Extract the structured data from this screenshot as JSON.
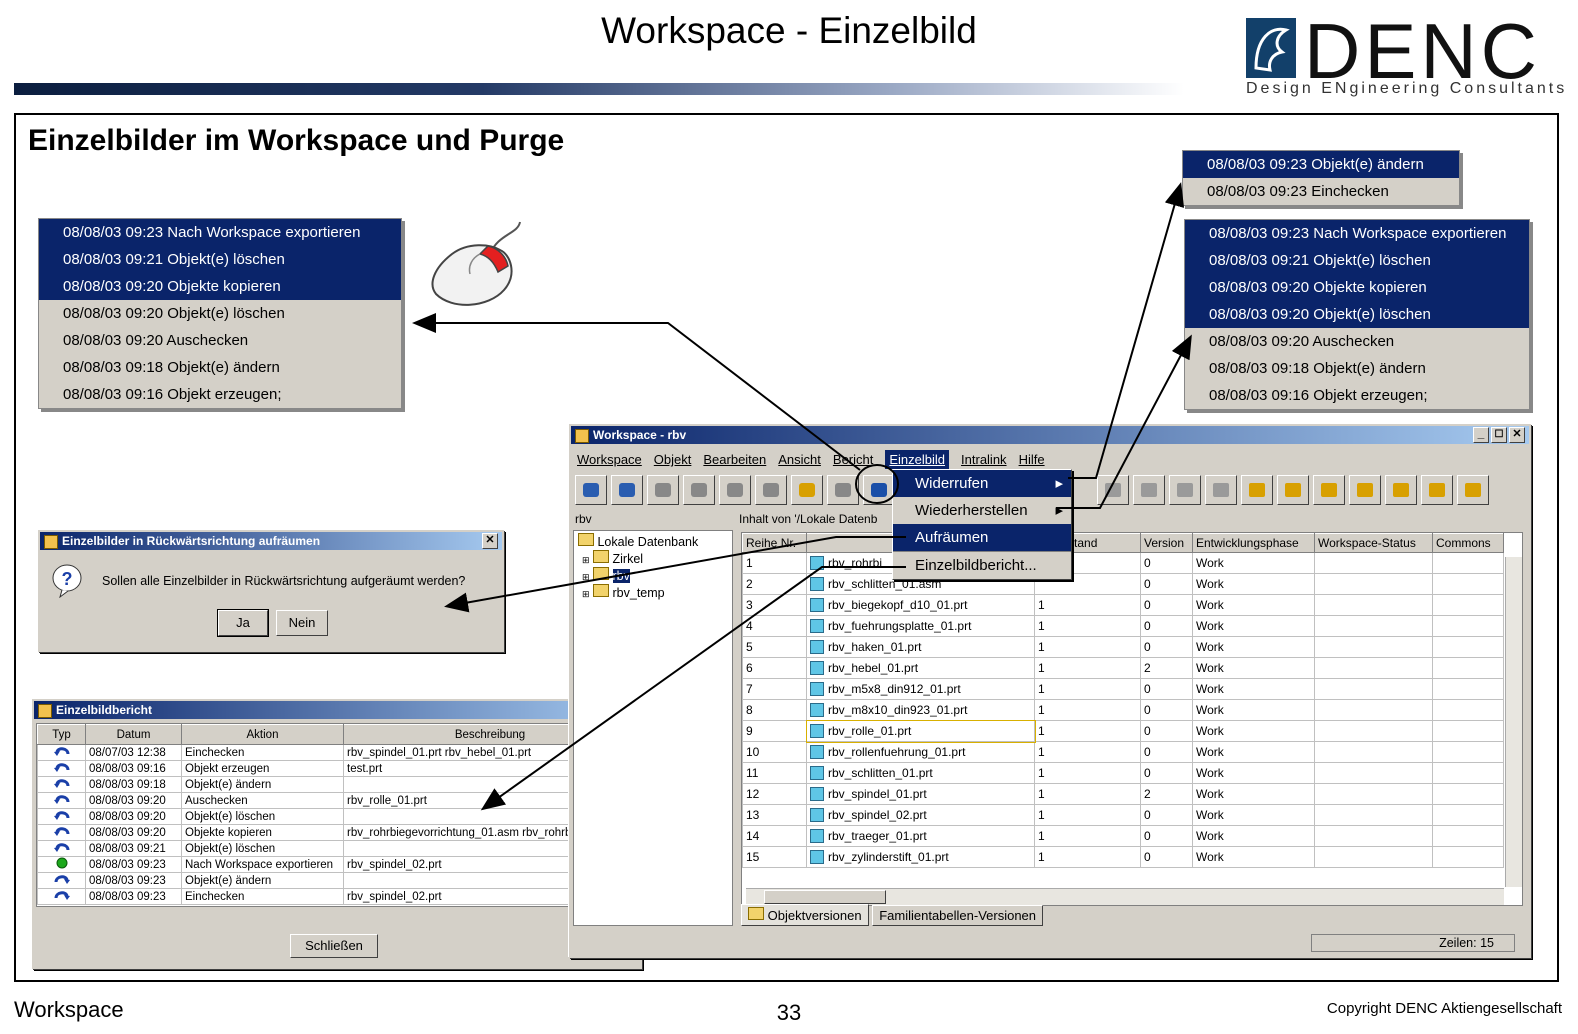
{
  "slide": {
    "title": "Workspace - Einzelbild",
    "heading": "Einzelbilder im Workspace und Purge",
    "footer_left": "Workspace",
    "page_number": "33",
    "copyright": "Copyright DENC Aktiengesellschaft"
  },
  "logo": {
    "word": "DENC",
    "sub": "Design ENgineering Consultants"
  },
  "history_left": [
    {
      "text": "08/08/03 09:23 Nach Workspace exportieren",
      "selected": true
    },
    {
      "text": "08/08/03 09:21 Objekt(e) löschen",
      "selected": true
    },
    {
      "text": "08/08/03 09:20 Objekte kopieren",
      "selected": true
    },
    {
      "text": "08/08/03 09:20 Objekt(e) löschen",
      "selected": false
    },
    {
      "text": "08/08/03 09:20 Auschecken",
      "selected": false
    },
    {
      "text": "08/08/03 09:18 Objekt(e) ändern",
      "selected": false
    },
    {
      "text": "08/08/03 09:16 Objekt erzeugen;",
      "selected": false
    }
  ],
  "history_top_right": [
    {
      "text": "08/08/03 09:23 Objekt(e) ändern",
      "selected": true
    },
    {
      "text": "08/08/03 09:23 Einchecken",
      "selected": false
    }
  ],
  "history_right": [
    {
      "text": "08/08/03 09:23 Nach Workspace exportieren",
      "selected": true
    },
    {
      "text": "08/08/03 09:21 Objekt(e) löschen",
      "selected": true
    },
    {
      "text": "08/08/03 09:20 Objekte kopieren",
      "selected": true
    },
    {
      "text": "08/08/03 09:20 Objekt(e) löschen",
      "selected": true
    },
    {
      "text": "08/08/03 09:20 Auschecken",
      "selected": false
    },
    {
      "text": "08/08/03 09:18 Objekt(e) ändern",
      "selected": false
    },
    {
      "text": "08/08/03 09:16 Objekt erzeugen;",
      "selected": false
    }
  ],
  "dialog": {
    "title": "Einzelbilder in Rückwärtsrichtung aufräumen",
    "message": "Sollen alle Einzelbilder in Rückwärtsrichtung aufgeräumt werden?",
    "yes": "Ja",
    "no": "Nein"
  },
  "report": {
    "title": "Einzelbildbericht",
    "columns": [
      "Typ",
      "Datum",
      "Aktion",
      "Beschreibung"
    ],
    "rows": [
      {
        "icon": "undo-icon",
        "date": "08/07/03 12:38",
        "action": "Einchecken",
        "desc": "rbv_spindel_01.prt rbv_hebel_01.prt"
      },
      {
        "icon": "undo-icon",
        "date": "08/08/03 09:16",
        "action": "Objekt erzeugen",
        "desc": "test.prt"
      },
      {
        "icon": "undo-icon",
        "date": "08/08/03 09:18",
        "action": "Objekt(e) ändern",
        "desc": ""
      },
      {
        "icon": "undo-icon",
        "date": "08/08/03 09:20",
        "action": "Auschecken",
        "desc": "rbv_rolle_01.prt"
      },
      {
        "icon": "undo-icon",
        "date": "08/08/03 09:20",
        "action": "Objekt(e) löschen",
        "desc": ""
      },
      {
        "icon": "undo-icon",
        "date": "08/08/03 09:20",
        "action": "Objekte kopieren",
        "desc": "rbv_rohrbiegevorrichtung_01.asm rbv_rohrbiegevo..."
      },
      {
        "icon": "undo-icon",
        "date": "08/08/03 09:21",
        "action": "Objekt(e) löschen",
        "desc": ""
      },
      {
        "icon": "current-dot-icon",
        "date": "08/08/03 09:23",
        "action": "Nach Workspace exportieren",
        "desc": "rbv_spindel_02.prt"
      },
      {
        "icon": "redo-icon",
        "date": "08/08/03 09:23",
        "action": "Objekt(e) ändern",
        "desc": ""
      },
      {
        "icon": "redo-icon",
        "date": "08/08/03 09:23",
        "action": "Einchecken",
        "desc": "rbv_spindel_02.prt"
      }
    ],
    "close": "Schließen"
  },
  "workspace": {
    "title": "Workspace - rbv",
    "menu": [
      "Workspace",
      "Objekt",
      "Bearbeiten",
      "Ansicht",
      "Bericht",
      "Einzelbild",
      "Intralink",
      "Hilfe"
    ],
    "tree_header": "rbv",
    "tree": {
      "root": "Lokale Datenbank",
      "items": [
        "Zirkel",
        "rbv",
        "rbv_temp"
      ]
    },
    "content_header": "Inhalt von '/Lokale Datenb",
    "columns": [
      "Reihe Nr.",
      "",
      "rungsstand",
      "Version",
      "Entwicklungsphase",
      "Workspace-Status",
      "Commons"
    ],
    "rows": [
      {
        "n": "1",
        "name": "rbv_rohrbi",
        "stand": "",
        "ver": "0",
        "phase": "Work"
      },
      {
        "n": "2",
        "name": "rbv_schlitten_01.asm",
        "stand": "",
        "ver": "0",
        "phase": "Work"
      },
      {
        "n": "3",
        "name": "rbv_biegekopf_d10_01.prt",
        "stand": "1",
        "ver": "0",
        "phase": "Work"
      },
      {
        "n": "4",
        "name": "rbv_fuehrungsplatte_01.prt",
        "stand": "1",
        "ver": "0",
        "phase": "Work"
      },
      {
        "n": "5",
        "name": "rbv_haken_01.prt",
        "stand": "1",
        "ver": "0",
        "phase": "Work"
      },
      {
        "n": "6",
        "name": "rbv_hebel_01.prt",
        "stand": "1",
        "ver": "2",
        "phase": "Work"
      },
      {
        "n": "7",
        "name": "rbv_m5x8_din912_01.prt",
        "stand": "1",
        "ver": "0",
        "phase": "Work"
      },
      {
        "n": "8",
        "name": "rbv_m8x10_din923_01.prt",
        "stand": "1",
        "ver": "0",
        "phase": "Work"
      },
      {
        "n": "9",
        "name": "rbv_rolle_01.prt",
        "stand": "1",
        "ver": "0",
        "phase": "Work"
      },
      {
        "n": "10",
        "name": "rbv_rollenfuehrung_01.prt",
        "stand": "1",
        "ver": "0",
        "phase": "Work"
      },
      {
        "n": "11",
        "name": "rbv_schlitten_01.prt",
        "stand": "1",
        "ver": "0",
        "phase": "Work"
      },
      {
        "n": "12",
        "name": "rbv_spindel_01.prt",
        "stand": "1",
        "ver": "2",
        "phase": "Work"
      },
      {
        "n": "13",
        "name": "rbv_spindel_02.prt",
        "stand": "1",
        "ver": "0",
        "phase": "Work"
      },
      {
        "n": "14",
        "name": "rbv_traeger_01.prt",
        "stand": "1",
        "ver": "0",
        "phase": "Work"
      },
      {
        "n": "15",
        "name": "rbv_zylinderstift_01.prt",
        "stand": "1",
        "ver": "0",
        "phase": "Work"
      }
    ],
    "tabs": [
      "Objektversionen",
      "Familientabellen-Versionen"
    ],
    "status": "Zeilen: 15"
  },
  "context_menu": {
    "items": [
      {
        "label": "Widerrufen",
        "submenu": true,
        "highlight": true
      },
      {
        "label": "Wiederherstellen",
        "submenu": true,
        "highlight": false
      },
      {
        "label": "Aufräumen",
        "submenu": false,
        "highlight": true
      },
      {
        "label": "Einzelbildbericht...",
        "submenu": false,
        "highlight": false
      }
    ]
  },
  "colors": {
    "selection": "#0a246a",
    "window_bg": "#d4d0c8",
    "logo_blue": "#12406a"
  }
}
